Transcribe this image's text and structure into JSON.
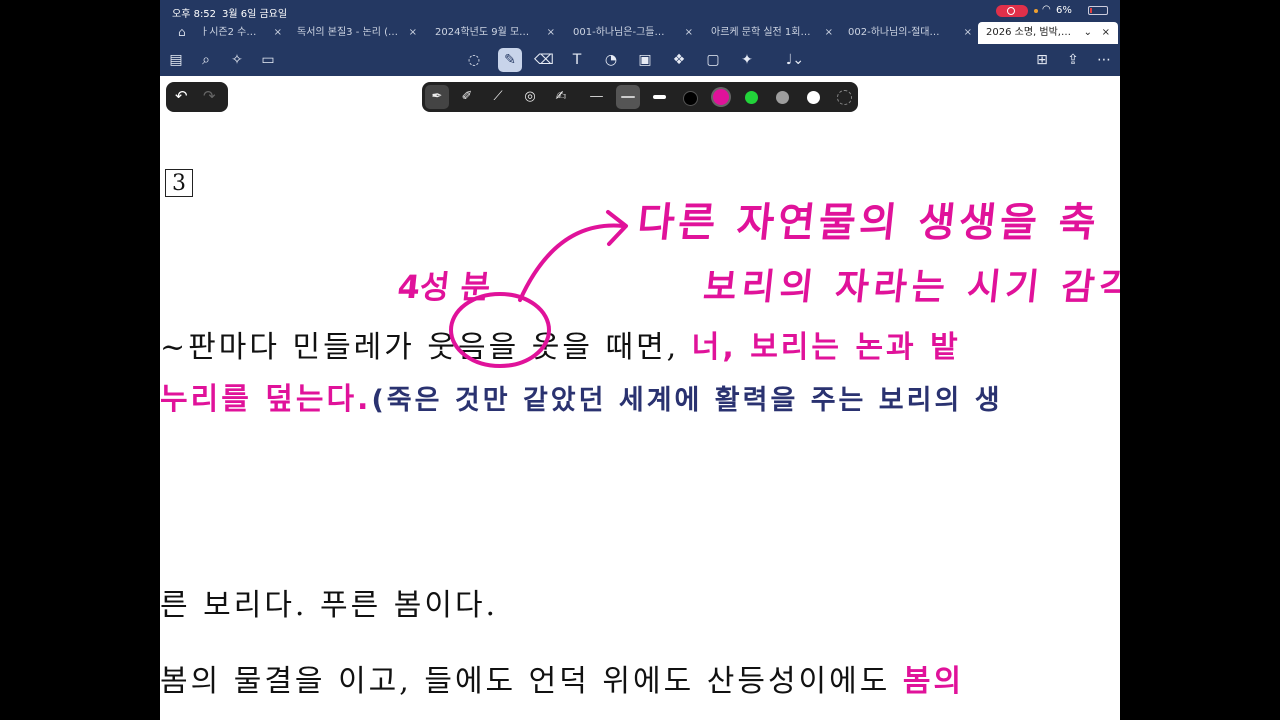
{
  "status_bar": {
    "time": "오후 8:52",
    "date": "3월 6일 금요일",
    "battery": "6%"
  },
  "tabs": [
    {
      "label": "ㅏ시즌2 수…",
      "active": false
    },
    {
      "label": "독서의 본질3 - 논리 (…",
      "active": false
    },
    {
      "label": "2024학년도 9월 모…",
      "active": false
    },
    {
      "label": "001-하나님은-그들…",
      "active": false
    },
    {
      "label": "아르케 문학 실전 1회…",
      "active": false
    },
    {
      "label": "002-하나님의-절대…",
      "active": false
    },
    {
      "label": "2026 소명, 범박,…",
      "active": true
    }
  ],
  "tab_close_symbol": "×",
  "tab_chevron": "⌄",
  "toolbar": {
    "icons": [
      "sidebar-icon",
      "search-icon",
      "sparkle-icon",
      "document-icon",
      "lasso-icon",
      "pen-icon",
      "eraser-icon",
      "text-box-icon",
      "shapes-icon",
      "image-icon",
      "elements-icon",
      "sticky-note-icon",
      "laser-pointer-icon",
      "microphone-icon",
      "add-page-icon",
      "share-icon",
      "more-icon"
    ],
    "selected": "pen-icon"
  },
  "pen_palette": {
    "tools": [
      "fountain-pen-icon",
      "ballpoint-pen-icon",
      "brush-pen-icon",
      "shape-pen-icon",
      "highlighter-icon"
    ],
    "selected_color": "#e0129a",
    "colors": [
      "#000000",
      "#e0129a",
      "#22d43a",
      "#9e9e9e",
      "#ffffff"
    ]
  },
  "document": {
    "question_number": "3",
    "line1_plain": "~판마다 민들레가 웃음을 웃을 때면, ",
    "line1_pink": "너, 보리는 논과 밭",
    "line2_pink": "누리를 덮는다.",
    "line2_navy": "(죽은 것만 같았던 세계에 활력을 주는 보리의 생",
    "line3": "른 보리다. 푸른 봄이다.",
    "line4_plain": "봄의 물결을 이고, 들에도 언덕 위에도 산등성이에도 ",
    "line4_pink": "봄의"
  },
  "annotations": {
    "note1": "다른 자연물의 생생을 축",
    "note2": "4성 분",
    "note3": "보리의 자라는 시기 감각"
  },
  "colors": {
    "accent": "#e0129a",
    "navy": "#2a3270",
    "chrome": "#243862"
  }
}
